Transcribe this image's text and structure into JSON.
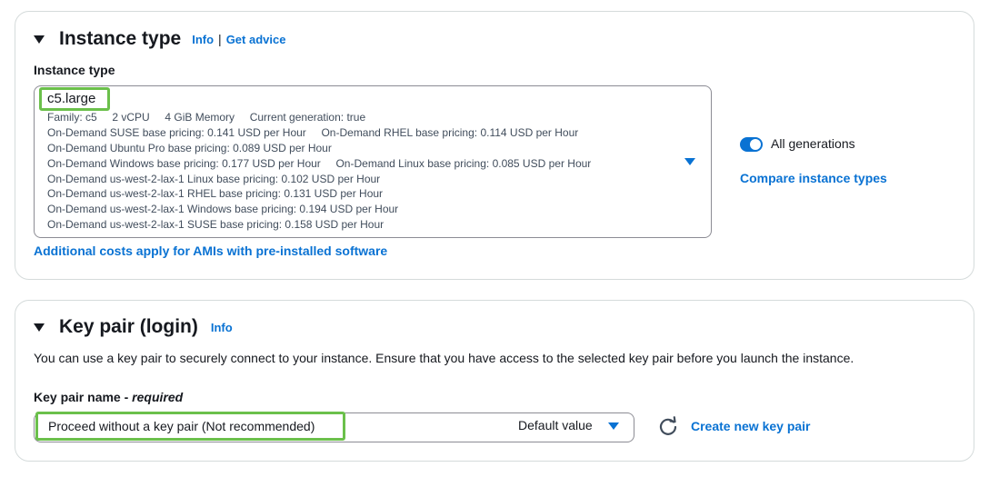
{
  "instance_type_panel": {
    "title": "Instance type",
    "info_link": "Info",
    "separator": "|",
    "advice_link": "Get advice",
    "field_label": "Instance type",
    "selected_type": "c5.large",
    "details": [
      "Family: c5     2 vCPU     4 GiB Memory     Current generation: true",
      "On-Demand SUSE base pricing: 0.141 USD per Hour     On-Demand RHEL base pricing: 0.114 USD per Hour",
      "On-Demand Ubuntu Pro base pricing: 0.089 USD per Hour",
      "On-Demand Windows base pricing: 0.177 USD per Hour     On-Demand Linux base pricing: 0.085 USD per Hour",
      "On-Demand us-west-2-lax-1 Linux base pricing: 0.102 USD per Hour",
      "On-Demand us-west-2-lax-1 RHEL base pricing: 0.131 USD per Hour",
      "On-Demand us-west-2-lax-1 Windows base pricing: 0.194 USD per Hour",
      "On-Demand us-west-2-lax-1 SUSE base pricing: 0.158 USD per Hour"
    ],
    "ami_costs_link": "Additional costs apply for AMIs with pre-installed software",
    "all_generations_label": "All generations",
    "all_generations_on": true,
    "compare_link": "Compare instance types"
  },
  "key_pair_panel": {
    "title": "Key pair (login)",
    "info_link": "Info",
    "description": "You can use a key pair to securely connect to your instance. Ensure that you have access to the selected key pair before you launch the instance.",
    "field_label": "Key pair name - ",
    "field_required": "required",
    "selected_value": "Proceed without a key pair (Not recommended)",
    "default_value_label": "Default value",
    "create_link": "Create new key pair"
  },
  "colors": {
    "link": "#0972d3",
    "highlight": "#6bc04b",
    "border": "#8c8c94"
  },
  "icons": [
    "caret-down-icon",
    "dropdown-arrow-icon",
    "toggle-switch",
    "refresh-icon"
  ]
}
